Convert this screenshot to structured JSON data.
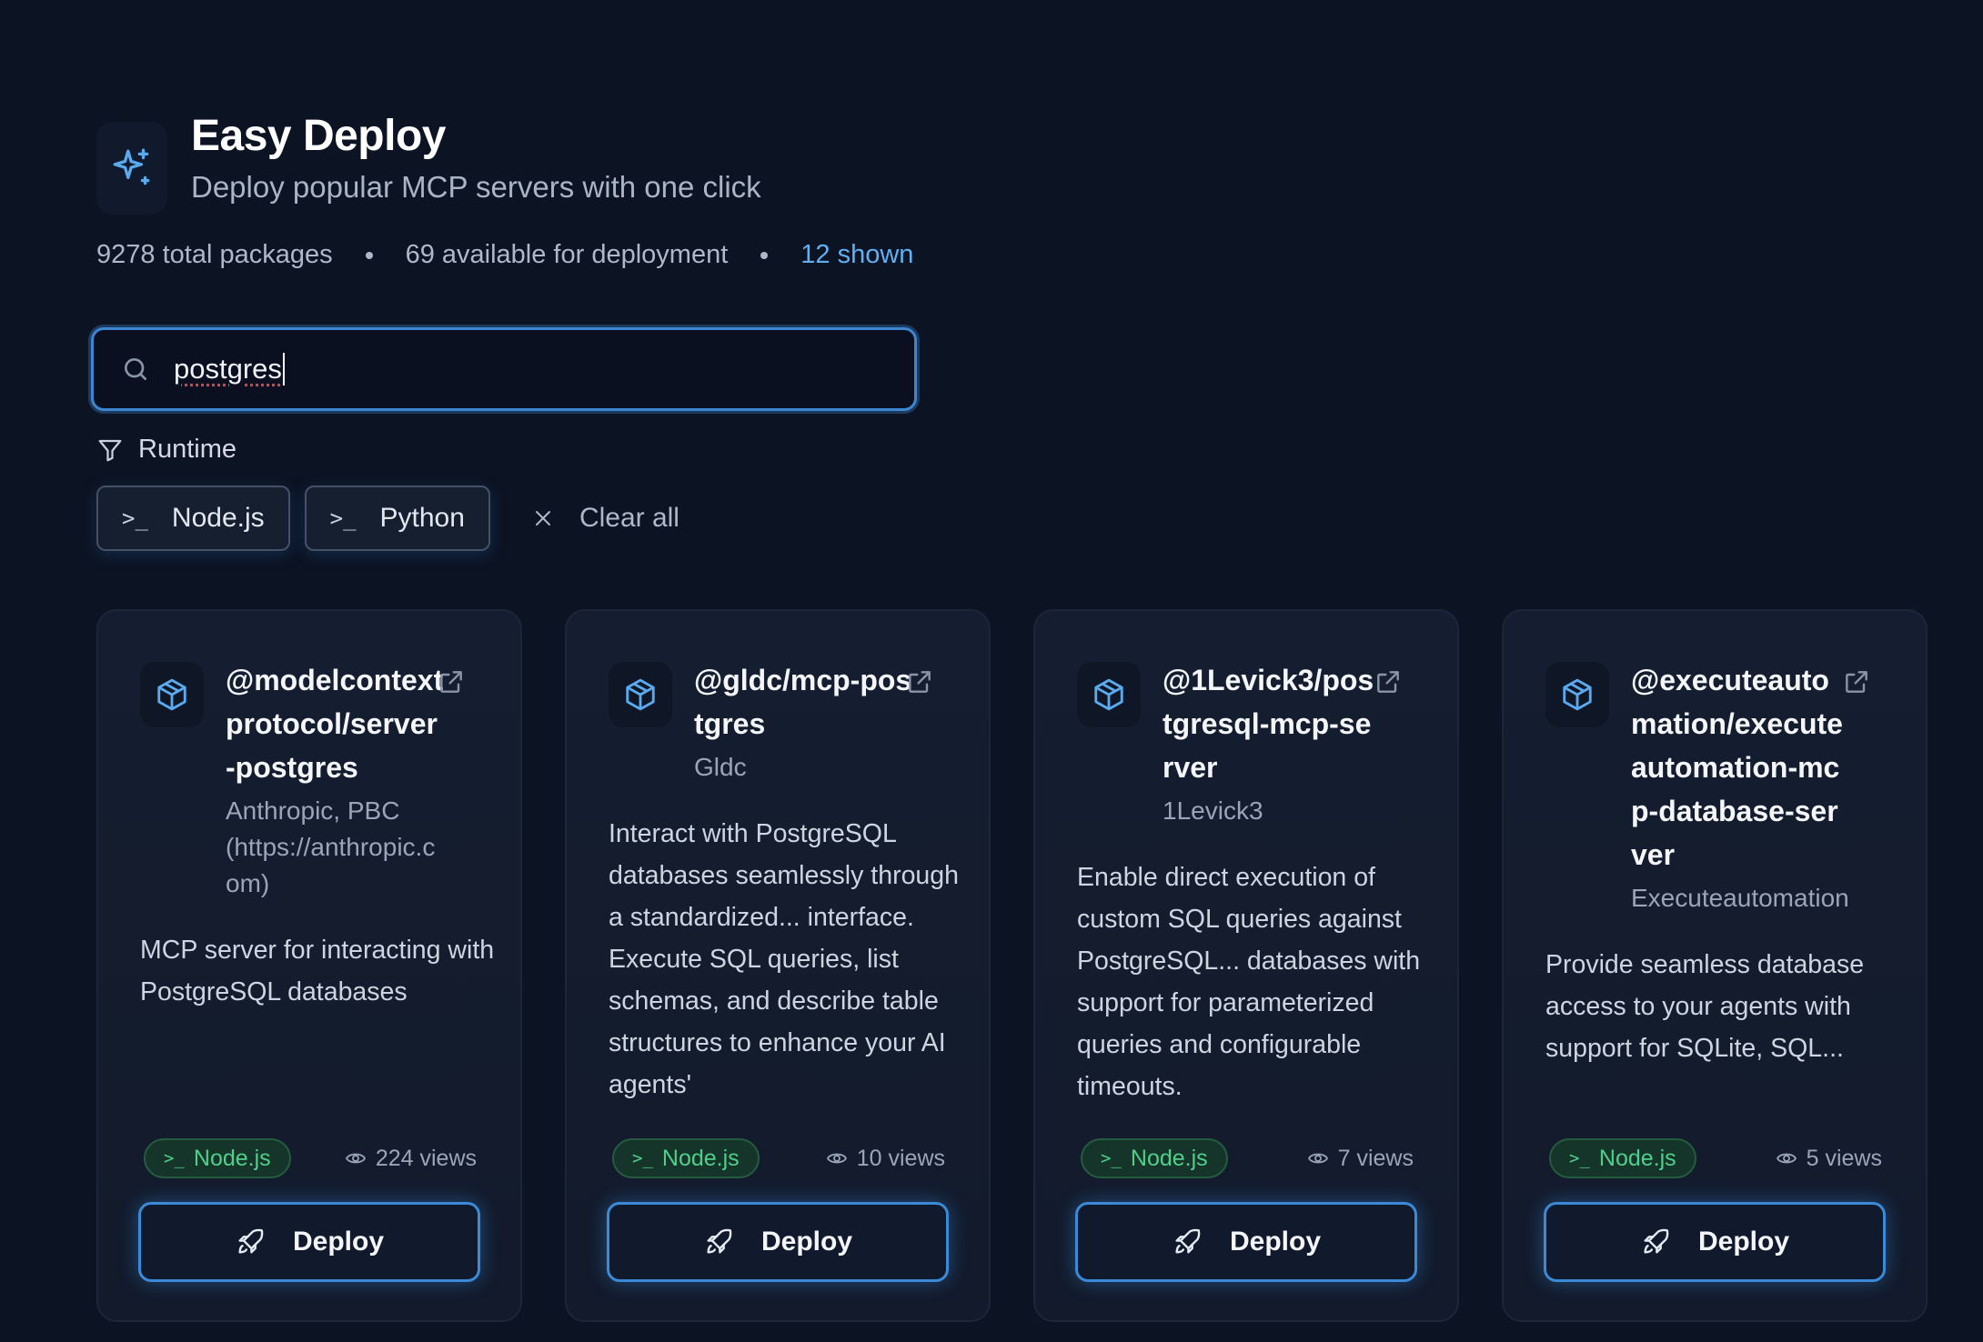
{
  "header": {
    "title": "Easy Deploy",
    "subtitle": "Deploy popular MCP servers with one click"
  },
  "stats": {
    "total": "9278 total packages",
    "available": "69 available for deployment",
    "shown": "12 shown"
  },
  "search": {
    "value": "postgres"
  },
  "filters": {
    "label": "Runtime",
    "chips": [
      "Node.js",
      "Python"
    ],
    "clear_label": "Clear all"
  },
  "cards": [
    {
      "name": "@modelcontextprotocol/server-postgres",
      "author": "Anthropic, PBC (https://anthropic.com)",
      "description": "MCP server for interacting with PostgreSQL databases",
      "runtime": "Node.js",
      "views": "224 views",
      "deploy_label": "Deploy"
    },
    {
      "name": "@gldc/mcp-postgres",
      "author": "Gldc",
      "description": "Interact with PostgreSQL databases seamlessly through a standardized... interface. Execute SQL queries, list schemas, and describe table structures to enhance your AI agents'",
      "runtime": "Node.js",
      "views": "10 views",
      "deploy_label": "Deploy"
    },
    {
      "name": "@1Levick3/postgresql-mcp-server",
      "author": "1Levick3",
      "description": "Enable direct execution of custom SQL queries against PostgreSQL... databases with support for parameterized queries and configurable timeouts.",
      "runtime": "Node.js",
      "views": "7 views",
      "deploy_label": "Deploy"
    },
    {
      "name": "@executeautomation/executeautomation-mcp-database-server",
      "author": "Executeautomation",
      "description": "Provide seamless database access to your agents with support for SQLite, SQL...",
      "runtime": "Node.js",
      "views": "5 views",
      "deploy_label": "Deploy"
    }
  ]
}
